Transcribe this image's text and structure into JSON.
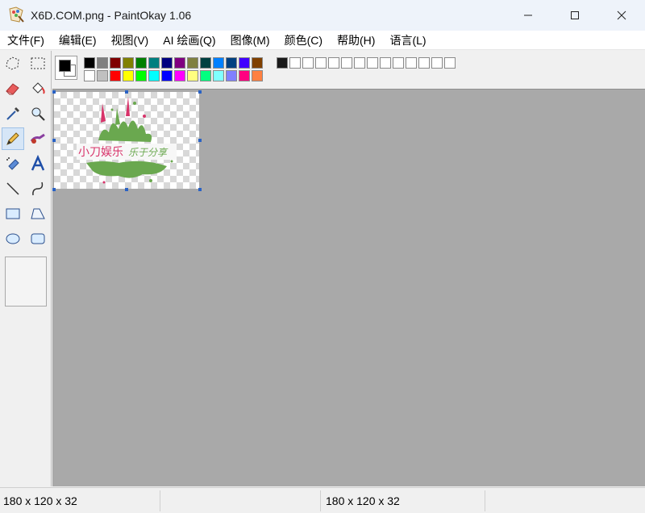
{
  "window": {
    "title": "X6D.COM.png - PaintOkay 1.06",
    "controls": {
      "minimize_icon": "minimize-icon",
      "maximize_icon": "maximize-icon",
      "close_icon": "close-icon"
    }
  },
  "menu": [
    {
      "label": "文件(F)"
    },
    {
      "label": "编辑(E)"
    },
    {
      "label": "视图(V)"
    },
    {
      "label": "AI 绘画(Q)"
    },
    {
      "label": "图像(M)"
    },
    {
      "label": "颜色(C)"
    },
    {
      "label": "帮助(H)"
    },
    {
      "label": "语言(L)"
    }
  ],
  "tools": [
    {
      "name": "free-select-icon"
    },
    {
      "name": "rect-select-icon"
    },
    {
      "name": "eraser-icon"
    },
    {
      "name": "fill-bucket-icon"
    },
    {
      "name": "color-picker-icon"
    },
    {
      "name": "magnifier-icon"
    },
    {
      "name": "pencil-icon",
      "active": true
    },
    {
      "name": "brush-icon"
    },
    {
      "name": "airbrush-icon"
    },
    {
      "name": "text-icon"
    },
    {
      "name": "line-icon"
    },
    {
      "name": "curve-icon"
    },
    {
      "name": "rectangle-icon"
    },
    {
      "name": "polygon-icon"
    },
    {
      "name": "ellipse-icon"
    },
    {
      "name": "rounded-rect-icon"
    }
  ],
  "palette": {
    "foreground": "#000000",
    "background": "#ffffff",
    "row1": [
      "#000000",
      "#808080",
      "#800000",
      "#808000",
      "#008000",
      "#008080",
      "#000080",
      "#800080",
      "#808040",
      "#004040",
      "#0080ff",
      "#004080",
      "#4000ff",
      "#804000"
    ],
    "row2": [
      "#ffffff",
      "#c0c0c0",
      "#ff0000",
      "#ffff00",
      "#00ff00",
      "#00ffff",
      "#0000ff",
      "#ff00ff",
      "#ffff80",
      "#00ff80",
      "#80ffff",
      "#8080ff",
      "#ff0080",
      "#ff8040"
    ],
    "custom": [
      "#1a1a1a",
      "#ffffff",
      "#ffffff",
      "#ffffff",
      "#ffffff",
      "#ffffff",
      "#ffffff",
      "#ffffff",
      "#ffffff",
      "#ffffff",
      "#ffffff",
      "#ffffff",
      "#ffffff",
      "#ffffff"
    ]
  },
  "image": {
    "logo_text": "小刀娱乐 乐于分享",
    "splash_color": "#6aa84f",
    "accent_color": "#e0457b"
  },
  "status": {
    "left": "180 x 120 x 32",
    "right": "180 x 120 x 32"
  }
}
